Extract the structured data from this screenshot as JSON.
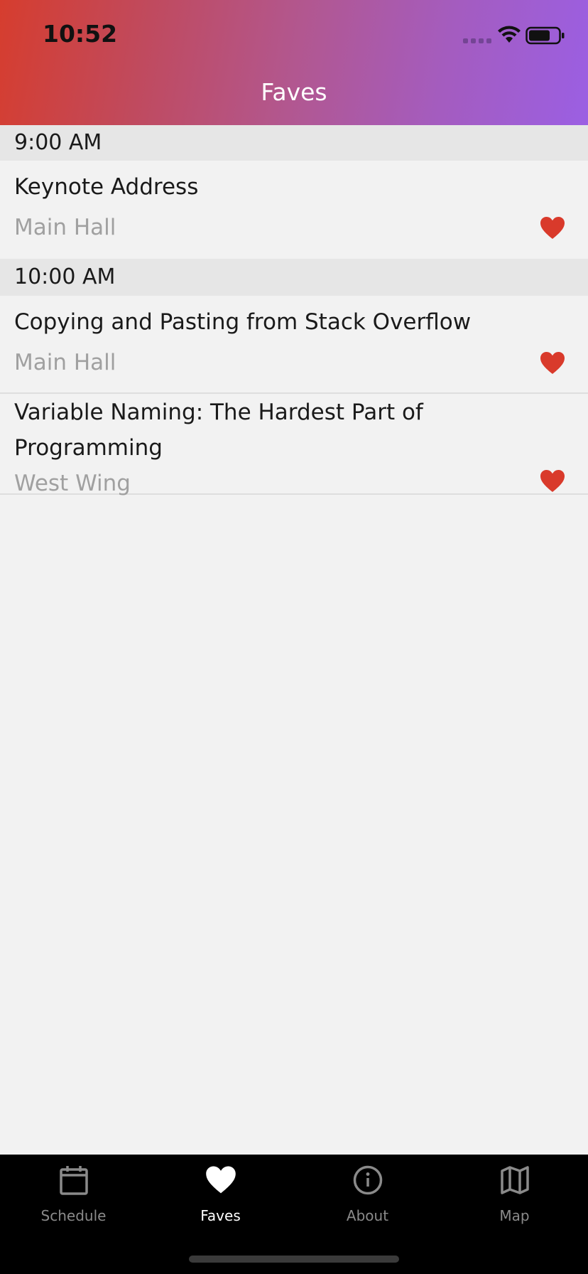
{
  "status_bar": {
    "time": "10:52"
  },
  "nav": {
    "title": "Faves"
  },
  "sections": [
    {
      "time": "9:00 AM",
      "items": [
        {
          "title": "Keynote Address",
          "room": "Main Hall",
          "favorited": true
        }
      ]
    },
    {
      "time": "10:00 AM",
      "items": [
        {
          "title": "Copying and Pasting from Stack Overflow",
          "room": "Main Hall",
          "favorited": true
        },
        {
          "title": "Variable Naming: The Hardest Part of Programming",
          "room": "West Wing",
          "favorited": true
        }
      ]
    }
  ],
  "tabs": [
    {
      "label": "Schedule",
      "icon": "calendar-icon",
      "active": false
    },
    {
      "label": "Faves",
      "icon": "heart-icon",
      "active": true
    },
    {
      "label": "About",
      "icon": "info-icon",
      "active": false
    },
    {
      "label": "Map",
      "icon": "map-icon",
      "active": false
    }
  ],
  "colors": {
    "heart": "#d93a2b",
    "header_start": "#d63d2e",
    "header_end": "#9b5fe3",
    "tab_active": "#ffffff",
    "tab_inactive": "#8a8a8a"
  }
}
